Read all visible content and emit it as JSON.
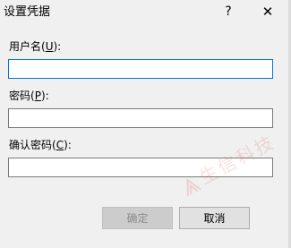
{
  "dialog": {
    "title": "设置凭据",
    "help_glyph": "?",
    "close_glyph": "✕"
  },
  "fields": {
    "username": {
      "label_prefix": "用户名(",
      "label_key": "U",
      "label_suffix": "):",
      "value": ""
    },
    "password": {
      "label_prefix": "密码(",
      "label_key": "P",
      "label_suffix": "):",
      "value": ""
    },
    "confirm": {
      "label_prefix": "确认密码(",
      "label_key": "C",
      "label_suffix": "):",
      "value": ""
    }
  },
  "buttons": {
    "ok_label": "确定",
    "cancel_label": "取消"
  },
  "watermark": {
    "text": "生信科技"
  },
  "colors": {
    "focus_border": "#0078d7",
    "watermark": "#dc3c3c"
  }
}
